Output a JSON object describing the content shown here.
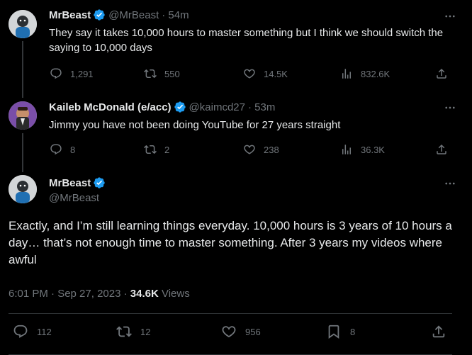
{
  "tweet1": {
    "name": "MrBeast",
    "handle": "@MrBeast",
    "time": "· 54m",
    "text": "They say it takes 10,000 hours to master something but I think we should switch the saying to 10,000 days",
    "replies": "1,291",
    "reposts": "550",
    "likes": "14.5K",
    "views": "832.6K"
  },
  "tweet2": {
    "name": "Kaileb McDonald (e/acc)",
    "handle": "@kaimcd27",
    "time": "· 53m",
    "text": "Jimmy you have not been doing YouTube for 27 years straight",
    "replies": "8",
    "reposts": "2",
    "likes": "238",
    "views": "36.3K"
  },
  "main": {
    "name": "MrBeast",
    "handle": "@MrBeast",
    "text": "Exactly, and I’m still learning things everyday. 10,000 hours is 3 years of 10 hours a day… that’s not enough time to master something. After 3 years my videos where awful",
    "timestamp": "6:01 PM · Sep 27, 2023 · ",
    "views_count": "34.6K",
    "views_label": " Views",
    "replies": "112",
    "reposts": "12",
    "likes": "956",
    "bookmarks": "8"
  },
  "colors": {
    "background": "#000000",
    "text": "#e7e9ea",
    "muted": "#71767b",
    "verified": "#1d9bf0"
  }
}
